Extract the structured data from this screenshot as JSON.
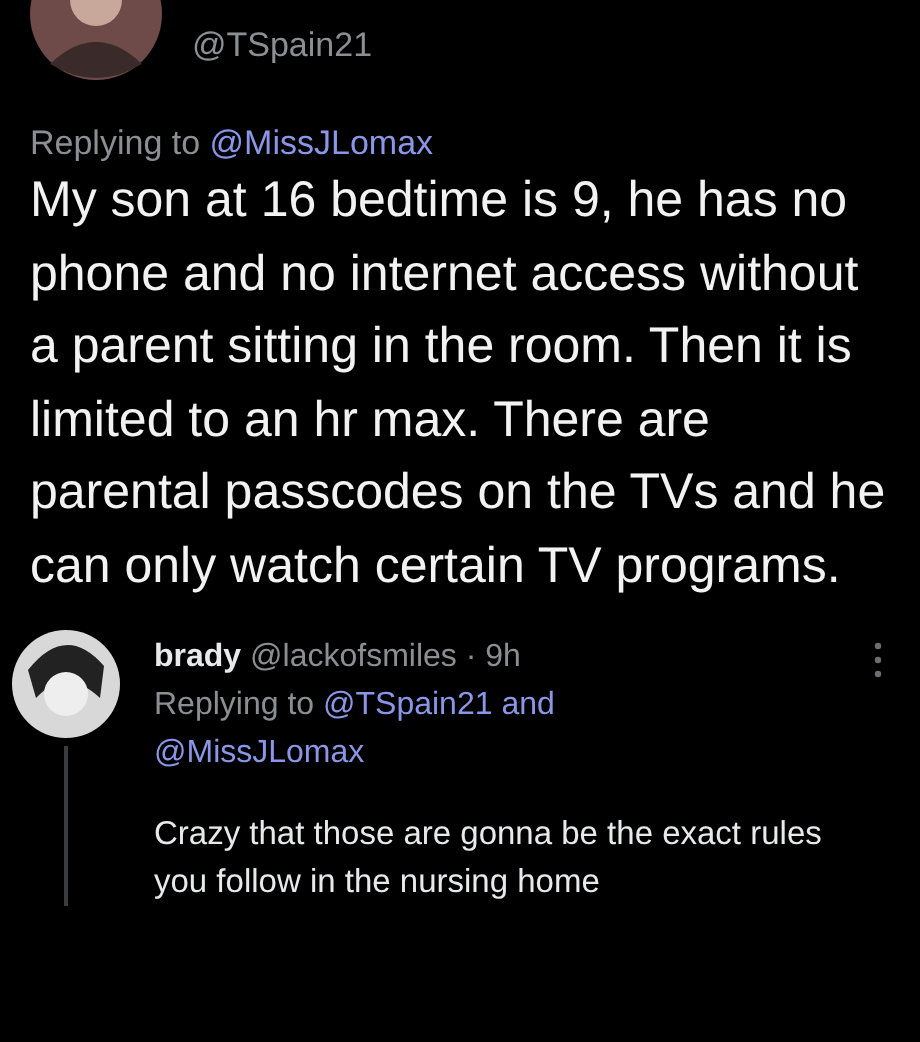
{
  "tweet": {
    "handle": "@TSpain21",
    "replying_label": "Replying to",
    "replying_to": "@MissJLomax",
    "text": "My son at 16 bedtime is 9, he has no phone and no internet access without a parent sitting in the room. Then it is limited to an hr max.  There are parental passcodes on the TVs and he can only watch certain TV programs."
  },
  "reply": {
    "name": "brady",
    "handle": "@lackofsmiles",
    "separator": "·",
    "time": "9h",
    "replying_label": "Replying to",
    "replying_to": [
      "@TSpain21",
      "@MissJLomax"
    ],
    "joiner": "and",
    "text": "Crazy that those are gonna be the exact rules you follow in the nursing home"
  }
}
